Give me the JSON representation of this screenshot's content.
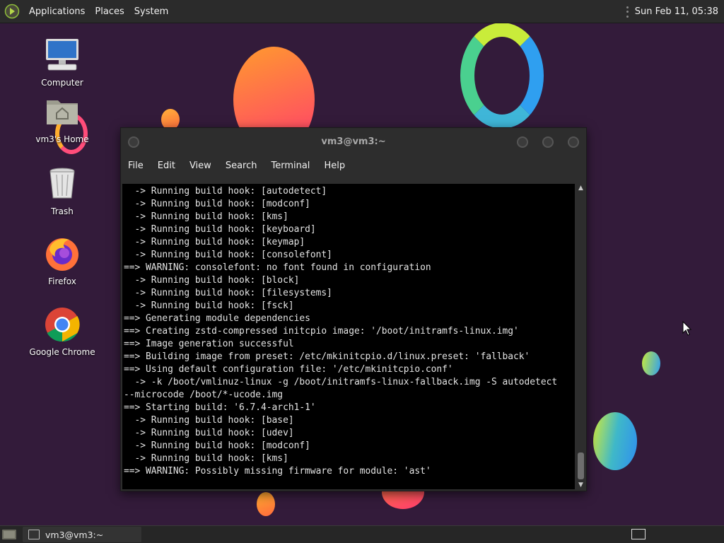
{
  "top_panel": {
    "menus": [
      "Applications",
      "Places",
      "System"
    ],
    "clock": "Sun Feb 11, 05:38"
  },
  "desktop_icons": [
    {
      "label": "Computer",
      "icon": "computer-icon"
    },
    {
      "label": "vm3's Home",
      "icon": "home-folder-icon"
    },
    {
      "label": "Trash",
      "icon": "trash-icon"
    },
    {
      "label": "Firefox",
      "icon": "firefox-icon"
    },
    {
      "label": "Google Chrome",
      "icon": "chrome-icon"
    }
  ],
  "terminal": {
    "title": "vm3@vm3:~",
    "menus": [
      "File",
      "Edit",
      "View",
      "Search",
      "Terminal",
      "Help"
    ],
    "lines": [
      "  -> Running build hook: [autodetect]",
      "  -> Running build hook: [modconf]",
      "  -> Running build hook: [kms]",
      "  -> Running build hook: [keyboard]",
      "  -> Running build hook: [keymap]",
      "  -> Running build hook: [consolefont]",
      "==> WARNING: consolefont: no font found in configuration",
      "  -> Running build hook: [block]",
      "  -> Running build hook: [filesystems]",
      "  -> Running build hook: [fsck]",
      "==> Generating module dependencies",
      "==> Creating zstd-compressed initcpio image: '/boot/initramfs-linux.img'",
      "==> Image generation successful",
      "==> Building image from preset: /etc/mkinitcpio.d/linux.preset: 'fallback'",
      "==> Using default configuration file: '/etc/mkinitcpio.conf'",
      "  -> -k /boot/vmlinuz-linux -g /boot/initramfs-linux-fallback.img -S autodetect",
      "--microcode /boot/*-ucode.img",
      "==> Starting build: '6.7.4-arch1-1'",
      "  -> Running build hook: [base]",
      "  -> Running build hook: [udev]",
      "  -> Running build hook: [modconf]",
      "  -> Running build hook: [kms]",
      "==> WARNING: Possibly missing firmware for module: 'ast'"
    ]
  },
  "bottom_panel": {
    "task_label": "vm3@vm3:~"
  },
  "colors": {
    "desktop_bg": "#331b3a",
    "panel_bg": "#2b2b2b",
    "terminal_bg": "#000000",
    "terminal_fg": "#e4e4e4"
  }
}
